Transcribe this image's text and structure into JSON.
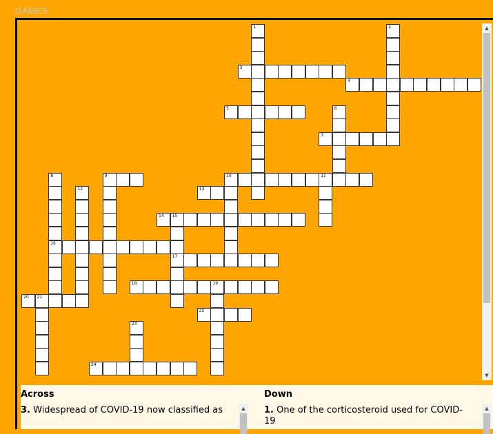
{
  "page": {
    "title": "GAMES"
  },
  "crossword": {
    "words": [
      {
        "num": "1",
        "dir": "down",
        "row": 0,
        "col": 17,
        "len": 13
      },
      {
        "num": "2",
        "dir": "down",
        "row": 0,
        "col": 27,
        "len": 9
      },
      {
        "num": "3",
        "dir": "across",
        "row": 3,
        "col": 16,
        "len": 8
      },
      {
        "num": "4",
        "dir": "across",
        "row": 4,
        "col": 24,
        "len": 10
      },
      {
        "num": "5",
        "dir": "across",
        "row": 6,
        "col": 15,
        "len": 6
      },
      {
        "num": "6",
        "dir": "down",
        "row": 6,
        "col": 23,
        "len": 5
      },
      {
        "num": "7",
        "dir": "across",
        "row": 8,
        "col": 22,
        "len": 6
      },
      {
        "num": "8",
        "dir": "down",
        "row": 11,
        "col": 2,
        "len": 10
      },
      {
        "num": "9",
        "dir": "across",
        "row": 11,
        "col": 6,
        "len": 3
      },
      {
        "num": "9d",
        "dir": "down",
        "row": 11,
        "col": 6,
        "len": 9
      },
      {
        "num": "10",
        "dir": "across",
        "row": 11,
        "col": 15,
        "len": 11
      },
      {
        "num": "11",
        "dir": "down",
        "row": 11,
        "col": 22,
        "len": 4
      },
      {
        "num": "12",
        "dir": "down",
        "row": 12,
        "col": 4,
        "len": 9
      },
      {
        "num": "13",
        "dir": "across",
        "row": 12,
        "col": 13,
        "len": 3
      },
      {
        "num": "13d",
        "dir": "down",
        "row": 12,
        "col": 15,
        "len": 5
      },
      {
        "num": "14",
        "dir": "across",
        "row": 14,
        "col": 10,
        "len": 11
      },
      {
        "num": "15",
        "dir": "down",
        "row": 14,
        "col": 11,
        "len": 7
      },
      {
        "num": "16",
        "dir": "across",
        "row": 16,
        "col": 2,
        "len": 10
      },
      {
        "num": "17",
        "dir": "across",
        "row": 17,
        "col": 11,
        "len": 8
      },
      {
        "num": "18",
        "dir": "across",
        "row": 19,
        "col": 8,
        "len": 11
      },
      {
        "num": "19",
        "dir": "down",
        "row": 19,
        "col": 14,
        "len": 7
      },
      {
        "num": "20",
        "dir": "across",
        "row": 20,
        "col": 0,
        "len": 5
      },
      {
        "num": "21",
        "dir": "down",
        "row": 20,
        "col": 1,
        "len": 6
      },
      {
        "num": "22",
        "dir": "across",
        "row": 21,
        "col": 13,
        "len": 4
      },
      {
        "num": "23",
        "dir": "down",
        "row": 22,
        "col": 8,
        "len": 4
      },
      {
        "num": "24",
        "dir": "across",
        "row": 25,
        "col": 5,
        "len": 8
      }
    ],
    "labels": [
      "1",
      "2",
      "3",
      "4",
      "5",
      "6",
      "7",
      "8",
      "9",
      "10",
      "11",
      "12",
      "13",
      "14",
      "15",
      "16",
      "17",
      "18",
      "19",
      "20",
      "21",
      "22",
      "23",
      "24"
    ]
  },
  "clues": {
    "across_heading": "Across",
    "down_heading": "Down",
    "across_first": {
      "num": "3.",
      "text": "Widespread of COVID-19 now classified as"
    },
    "down_first": {
      "num": "1.",
      "text": "One of the corticosteroid used for COVID-19"
    }
  },
  "colors": {
    "background": "#ffa500",
    "cell": "#ffffff",
    "clues_bg": "#fff8e7"
  }
}
